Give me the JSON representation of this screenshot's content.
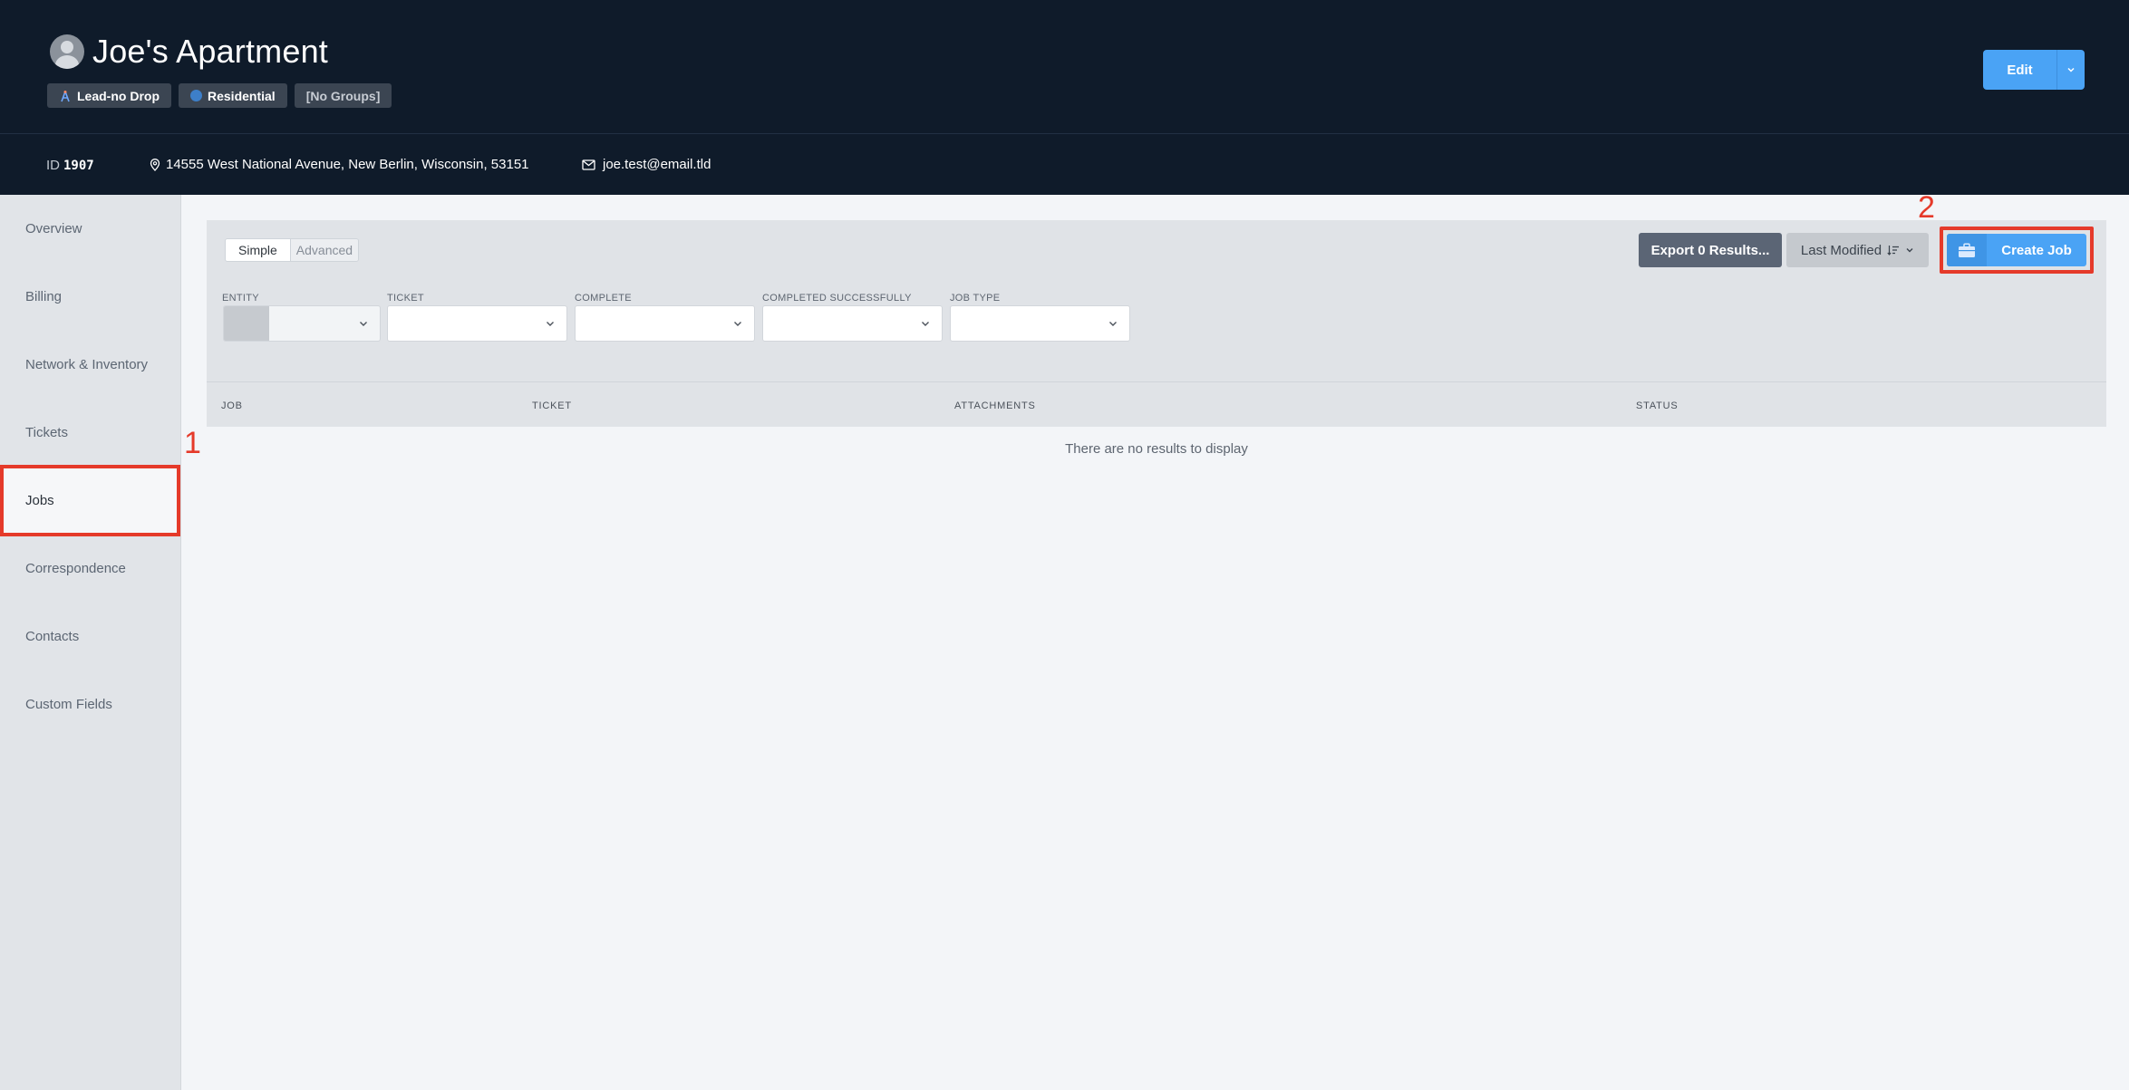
{
  "header": {
    "title": "Joe's Apartment",
    "badges": {
      "lead": "Lead-no Drop",
      "type": "Residential",
      "groups": "[No Groups]"
    },
    "edit_label": "Edit",
    "id_label": "ID",
    "id_value": "1907",
    "address": "14555 West National Avenue, New Berlin, Wisconsin, 53151",
    "email": "joe.test@email.tld"
  },
  "sidebar": {
    "items": [
      {
        "label": "Overview"
      },
      {
        "label": "Billing"
      },
      {
        "label": "Network & Inventory"
      },
      {
        "label": "Tickets"
      },
      {
        "label": "Jobs"
      },
      {
        "label": "Correspondence"
      },
      {
        "label": "Contacts"
      },
      {
        "label": "Custom Fields"
      }
    ],
    "active": "Jobs"
  },
  "toolbar": {
    "mode_simple": "Simple",
    "mode_advanced": "Advanced",
    "export_label": "Export 0 Results...",
    "sort_label": "Last Modified",
    "create_label": "Create Job"
  },
  "filters": {
    "entity": "ENTITY",
    "ticket": "TICKET",
    "complete": "COMPLETE",
    "completed_successfully": "COMPLETED SUCCESSFULLY",
    "job_type": "JOB TYPE"
  },
  "table": {
    "columns": [
      "JOB",
      "TICKET",
      "ATTACHMENTS",
      "STATUS"
    ],
    "empty_message": "There are no results to display"
  },
  "annotations": {
    "one": "1",
    "two": "2"
  },
  "colors": {
    "header_bg": "#0f1b2a",
    "accent": "#4aa3f5",
    "highlight": "#e53a2a"
  }
}
